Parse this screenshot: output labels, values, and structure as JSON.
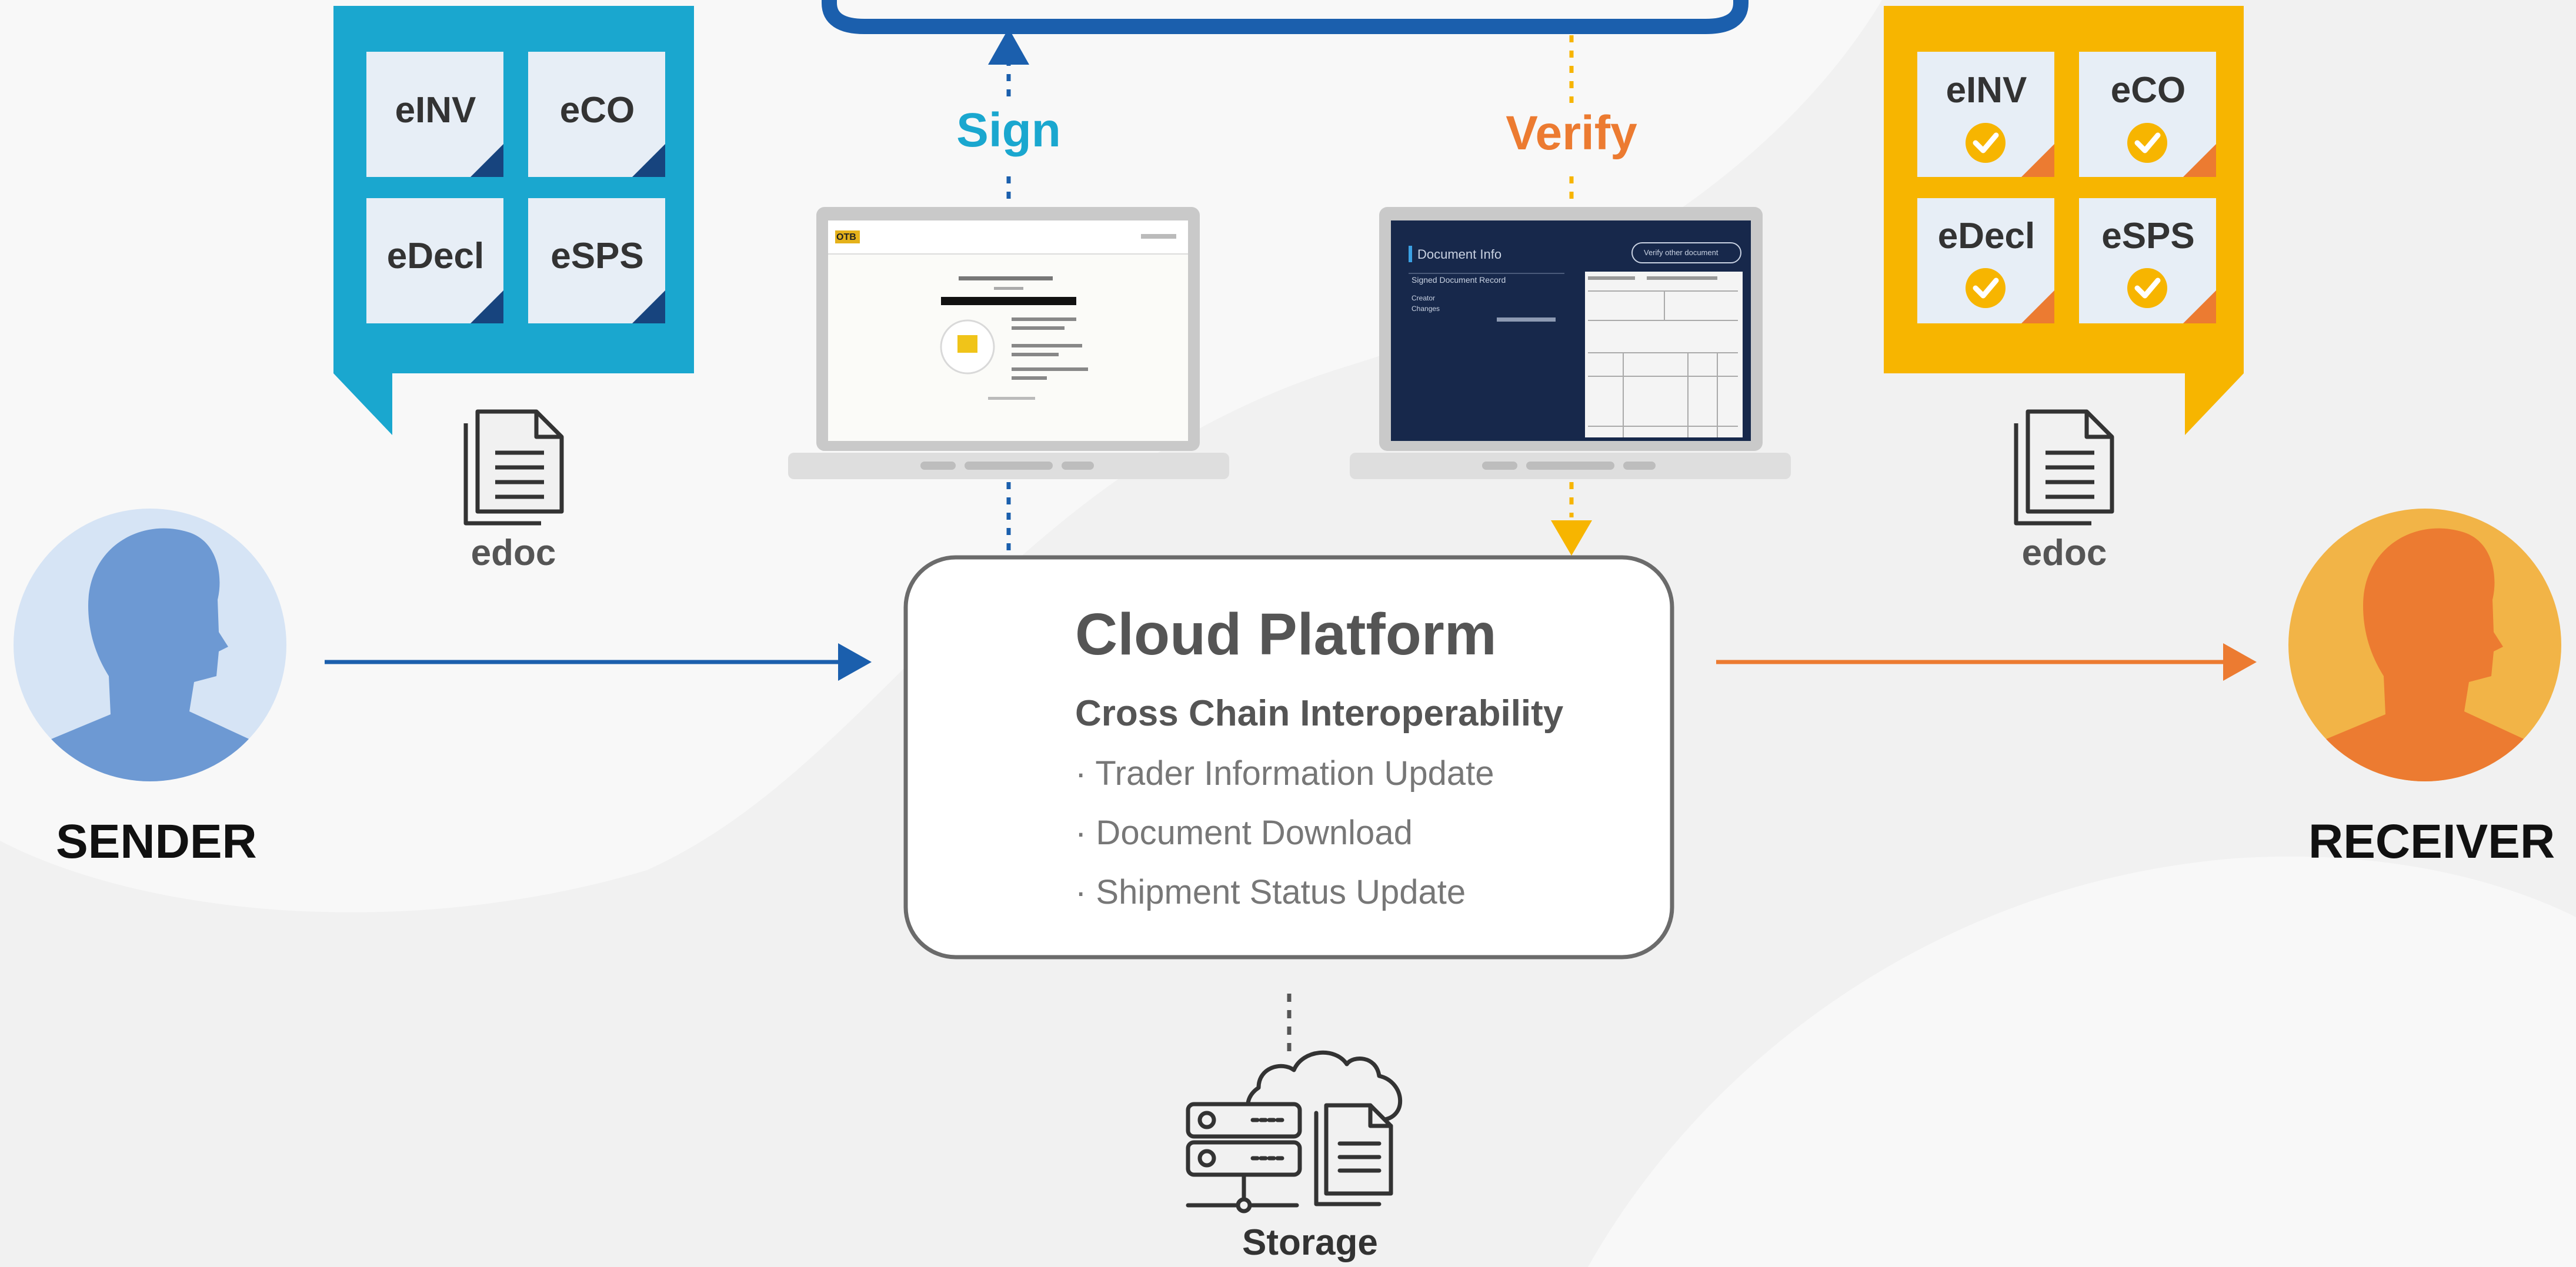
{
  "sender": {
    "label": "SENDER",
    "edoc_label": "edoc",
    "documents": [
      "eINV",
      "eCO",
      "eDecl",
      "eSPS"
    ],
    "color": "#1aa7cf",
    "arrow_color": "#1b5fad"
  },
  "receiver": {
    "label": "RECEIVER",
    "edoc_label": "edoc",
    "documents": [
      "eINV",
      "eCO",
      "eDecl",
      "eSPS"
    ],
    "color": "#f7b500",
    "arrow_color": "#ec7b31"
  },
  "actions": {
    "sign_label": "Sign",
    "sign_color": "#1aa7cf",
    "verify_label": "Verify",
    "verify_color": "#ec7b31"
  },
  "laptops": {
    "verify_screen": {
      "header": "Document Info",
      "button": "Verify other document",
      "row1": "Signed Document Record",
      "row2": "Creator",
      "row3": "Changes"
    },
    "sign_screen": {
      "logo": "OTB"
    }
  },
  "cloud_platform": {
    "title": "Cloud Platform",
    "subtitle": "Cross Chain Interoperability",
    "items": [
      "· Trader Information Update",
      "· Document Download",
      "· Shipment Status Update"
    ]
  },
  "storage": {
    "label": "Storage"
  },
  "colors": {
    "background": "#f1f1f1",
    "top_border": "#1b5fad",
    "cloud_border": "#6b6b6b"
  }
}
